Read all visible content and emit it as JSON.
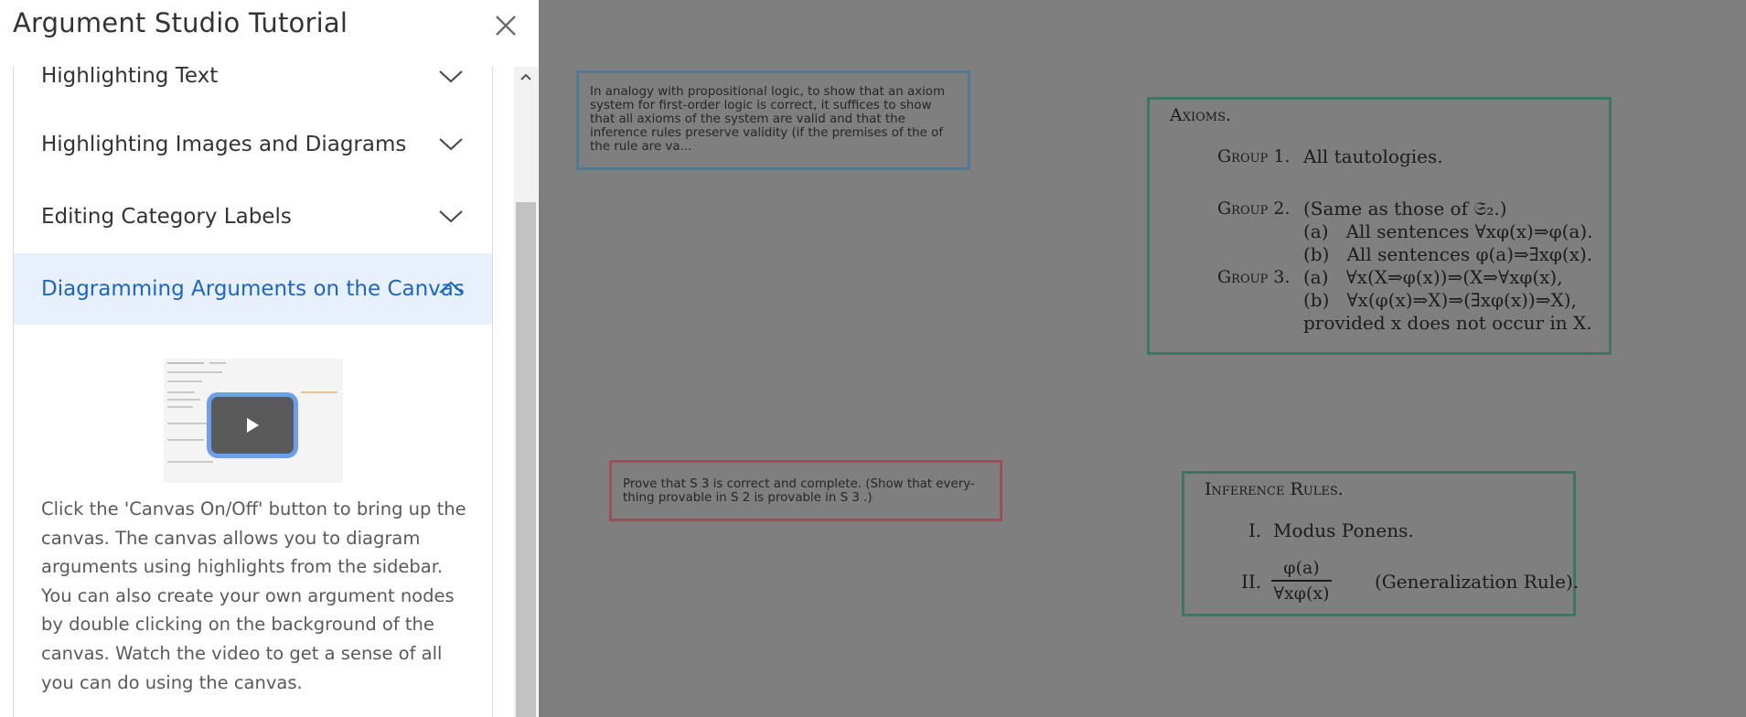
{
  "sidebar": {
    "title": "Argument Studio Tutorial",
    "close_icon": "close-icon",
    "sections": [
      {
        "label": "Highlighting Text",
        "expanded": false
      },
      {
        "label": "Highlighting Images and Diagrams",
        "expanded": false
      },
      {
        "label": "Editing Category Labels",
        "expanded": false
      },
      {
        "label": "Diagramming Arguments on the Canvas",
        "expanded": true
      }
    ],
    "active_panel": {
      "video_icon": "play-icon",
      "description": "Click the 'Canvas On/Off' button to bring up the canvas. The canvas allows you to diagram arguments using highlights from the sidebar. You can also create your own argument nodes by double clicking on the background of the canvas. Watch the video to get a sense of all you can do using the canvas."
    }
  },
  "canvas": {
    "text_nodes": [
      {
        "text": "In analogy with propositional logic, to show that an axiom system for first-order logic is correct, it suffices to show that all axioms of the system are valid and that the inference rules preserve validity (if the premises of the of the rule are va...",
        "color": "#517b95"
      },
      {
        "text": "Prove that S 3 is correct and complete. (Show that every-thing provable in S 2 is provable in S 3 .)",
        "color": "#9c4f58"
      }
    ],
    "figures": {
      "axioms": {
        "heading": "Axioms.",
        "group1_label": "Group 1.",
        "group1_text": "All tautologies.",
        "group2_label": "Group 2.",
        "group2_text": "(Same as those of 𝔖₂.)",
        "group2_a": "(a)   All sentences ∀xφ(x)⇒φ(a).",
        "group2_b": "(b)   All sentences φ(a)⇒∃xφ(x).",
        "group3_label": "Group 3.",
        "group3_a": "(a)   ∀x(X⇒φ(x))⇒(X⇒∀xφ(x),",
        "group3_b": "(b)   ∀x(φ(x)⇒X)⇒(∃xφ(x))⇒X),",
        "group3_c": "provided x does not occur in X."
      },
      "rules": {
        "heading": "Inference Rules.",
        "rule1": "I.  Modus Ponens.",
        "rule2_label": "II.",
        "rule2_num": "φ(a)",
        "rule2_den": "∀xφ(x)",
        "rule2_name": "(Generalization Rule)."
      },
      "border_color": "#3f7662"
    },
    "background": "#7f7f7f"
  }
}
